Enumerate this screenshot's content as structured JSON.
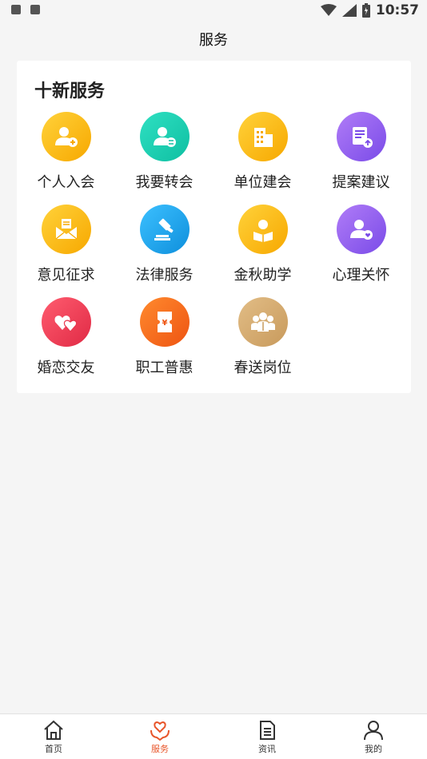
{
  "status_bar": {
    "time": "10:57"
  },
  "header": {
    "title": "服务"
  },
  "section": {
    "title": "十新服务"
  },
  "services": [
    {
      "label": "个人入会",
      "icon": "person-add-icon",
      "color": "#f9b800"
    },
    {
      "label": "我要转会",
      "icon": "person-transfer-icon",
      "color": "#16c9b0"
    },
    {
      "label": "单位建会",
      "icon": "building-icon",
      "color": "#f9b800"
    },
    {
      "label": "提案建议",
      "icon": "proposal-doc-icon",
      "color": "#8b5cf6"
    },
    {
      "label": "意见征求",
      "icon": "mail-open-icon",
      "color": "#f9b800"
    },
    {
      "label": "法律服务",
      "icon": "gavel-icon",
      "color": "#1aa3e8"
    },
    {
      "label": "金秋助学",
      "icon": "student-reading-icon",
      "color": "#f9b800"
    },
    {
      "label": "心理关怀",
      "icon": "person-heart-icon",
      "color": "#8b5cf6"
    },
    {
      "label": "婚恋交友",
      "icon": "double-heart-icon",
      "color": "#ee3a4f"
    },
    {
      "label": "职工普惠",
      "icon": "coupon-yen-icon",
      "color": "#f46a1f"
    },
    {
      "label": "春送岗位",
      "icon": "group-people-icon",
      "color": "#cfa46a"
    }
  ],
  "tabbar": {
    "items": [
      {
        "label": "首页",
        "icon": "home-icon"
      },
      {
        "label": "服务",
        "icon": "service-heart-icon",
        "active": true
      },
      {
        "label": "资讯",
        "icon": "news-doc-icon"
      },
      {
        "label": "我的",
        "icon": "profile-icon"
      }
    ],
    "active_color": "#e8552a"
  }
}
